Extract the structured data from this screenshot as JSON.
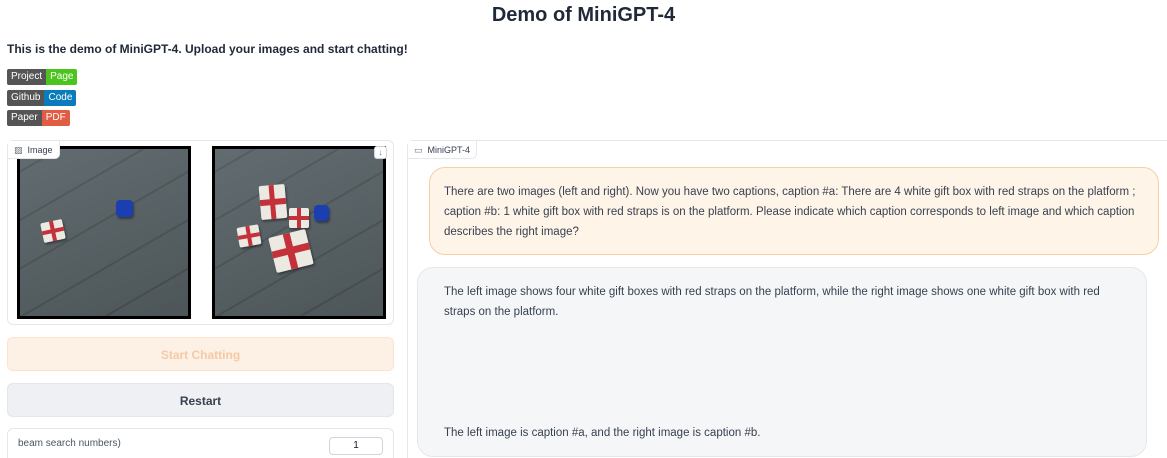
{
  "header": {
    "title": "Demo of MiniGPT-4",
    "subtitle": "This is the demo of MiniGPT-4. Upload your images and start chatting!"
  },
  "badges": [
    {
      "left": "Project",
      "right": "Page",
      "color": "#4bc51d"
    },
    {
      "left": "Github",
      "right": "Code",
      "color": "#0a7bbb"
    },
    {
      "left": "Paper",
      "right": "PDF",
      "color": "#e05d44"
    }
  ],
  "image_panel": {
    "label": "Image"
  },
  "buttons": {
    "start": "Start Chatting",
    "restart": "Restart"
  },
  "beam": {
    "label": "beam search numbers)",
    "value": "1"
  },
  "chat": {
    "label": "MiniGPT-4",
    "user_message": "There are two images (left and right). Now you have two captions, caption #a: There are 4 white gift box with red straps on the platform ; caption #b: 1 white gift box with red straps is on the platform. Please indicate which caption corresponds to left image and which caption describes the right image?",
    "bot_message_1": "The left image shows four white gift boxes with red straps on the platform, while the right image shows one white gift box with red straps on the platform.",
    "bot_message_2": "The left image is caption #a, and the right image is caption #b."
  }
}
